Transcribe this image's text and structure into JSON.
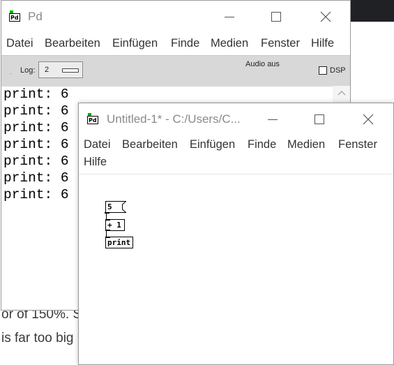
{
  "background": {
    "text_line_1": "or of 150%. S",
    "text_line_2": "is far too big"
  },
  "pd_window": {
    "title": "Pd",
    "menu": [
      "Datei",
      "Bearbeiten",
      "Einfügen",
      "Finde",
      "Medien",
      "Fenster",
      "Hilfe"
    ],
    "toolbar": {
      "log_label": "Log:",
      "log_value": "2",
      "audio_status": "Audio aus",
      "dsp_label": "DSP",
      "dsp_checked": false
    },
    "console_lines": [
      "print: 6",
      "print: 6",
      "print: 6",
      "print: 6",
      "print: 6",
      "print: 6",
      "print: 6"
    ]
  },
  "patch_window": {
    "title": "Untitled-1* - C:/Users/C...",
    "menu": [
      "Datei",
      "Bearbeiten",
      "Einfügen",
      "Finde",
      "Medien",
      "Fenster",
      "Hilfe"
    ],
    "objects": {
      "message": "5",
      "add": "+ 1",
      "print": "print"
    }
  },
  "colors": {
    "toolbar_bg": "#d8d8d8",
    "title_text": "#8a8a8a",
    "pd_logo_green": "#00b000"
  },
  "icons": [
    "pd-logo-icon",
    "minimize-icon",
    "maximize-icon",
    "close-icon",
    "scroll-up-arrow-icon"
  ]
}
